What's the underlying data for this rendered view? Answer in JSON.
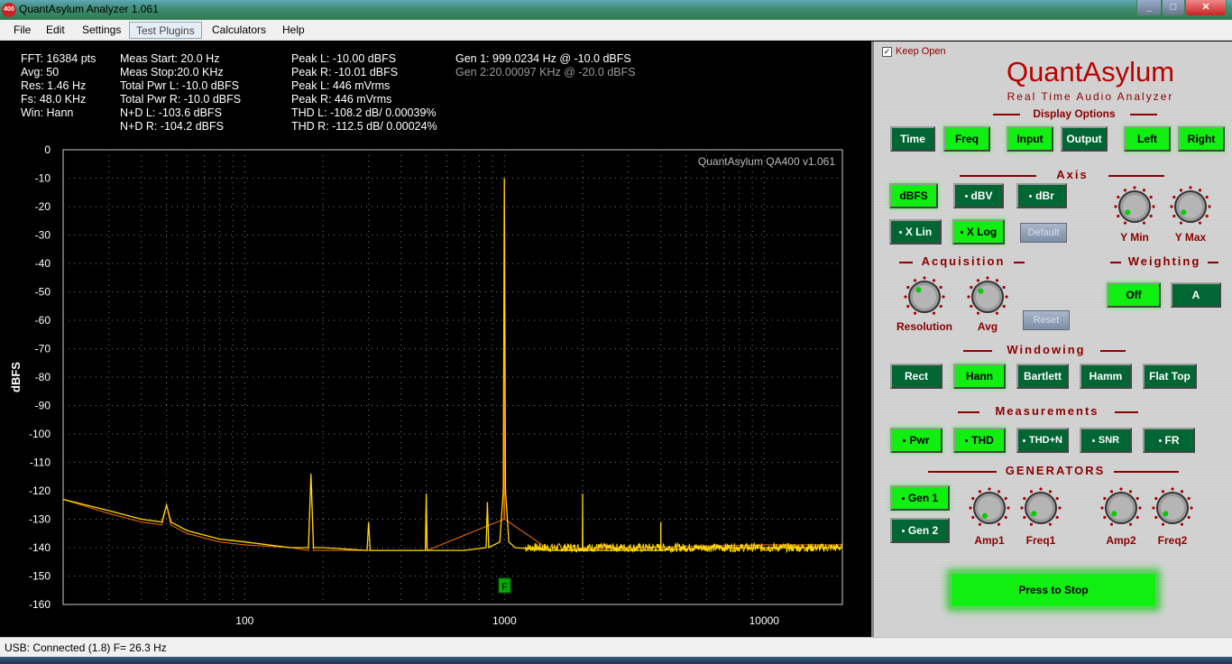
{
  "window": {
    "title": "QuantAsylum Analyzer 1.061",
    "icon_text": "400"
  },
  "menu": [
    "File",
    "Edit",
    "Settings",
    "Test Plugins",
    "Calculators",
    "Help"
  ],
  "stats": {
    "col1": [
      "FFT: 16384 pts",
      "Avg: 50",
      "Res: 1.46 Hz",
      "Fs: 48.0 KHz",
      "Win: Hann"
    ],
    "col2": [
      "Meas Start: 20.0 Hz",
      "Meas Stop:20.0 KHz",
      "Total Pwr L: -10.0 dBFS",
      "Total Pwr R: -10.0 dBFS",
      "N+D L: -103.6 dBFS",
      "N+D R: -104.2 dBFS"
    ],
    "col3": [
      "Peak L: -10.00 dBFS",
      "Peak R: -10.01 dBFS",
      "Peak L: 446 mVrms",
      "Peak R: 446 mVrms",
      "THD L: -108.2 dB/ 0.00039%",
      "THD R: -112.5 dB/ 0.00024%"
    ],
    "col4": [
      "Gen 1: 999.0234 Hz @ -10.0  dBFS",
      "Gen 2:20.00097 KHz @ -20.0  dBFS"
    ]
  },
  "chart_data": {
    "type": "line",
    "ylabel": "dBFS",
    "watermark": "QuantAsylum QA400 v1.061",
    "x_scale": "log",
    "xlim": [
      20,
      20000
    ],
    "ylim": [
      -160,
      0
    ],
    "y_ticks": [
      "0",
      "-10",
      "-20",
      "-30",
      "-40",
      "-50",
      "-60",
      "-70",
      "-80",
      "-90",
      "-100",
      "-110",
      "-120",
      "-130",
      "-140",
      "-150",
      "-160"
    ],
    "x_ticks": [
      {
        "value": 100,
        "label": "100"
      },
      {
        "value": 1000,
        "label": "1000"
      },
      {
        "value": 10000,
        "label": "10000"
      }
    ],
    "grid": true,
    "marker_label": "F",
    "series": [
      {
        "color": "#ffd700",
        "points": [
          [
            20,
            -123
          ],
          [
            30,
            -127
          ],
          [
            40,
            -130
          ],
          [
            48,
            -131
          ],
          [
            50,
            -125
          ],
          [
            52,
            -131
          ],
          [
            60,
            -134
          ],
          [
            80,
            -137
          ],
          [
            100,
            -138
          ],
          [
            150,
            -140
          ],
          [
            176,
            -140
          ],
          [
            180,
            -114
          ],
          [
            184,
            -140
          ],
          [
            200,
            -140
          ],
          [
            296,
            -141
          ],
          [
            300,
            -131
          ],
          [
            304,
            -141
          ],
          [
            400,
            -141
          ],
          [
            496,
            -141
          ],
          [
            500,
            -121
          ],
          [
            504,
            -141
          ],
          [
            700,
            -141
          ],
          [
            850,
            -140
          ],
          [
            860,
            -124
          ],
          [
            870,
            -140
          ],
          [
            960,
            -138
          ],
          [
            990,
            -120
          ],
          [
            999,
            -10
          ],
          [
            1010,
            -120
          ],
          [
            1040,
            -138
          ],
          [
            1100,
            -140
          ],
          [
            1500,
            -141
          ],
          [
            1996,
            -141
          ],
          [
            2000,
            -121
          ],
          [
            2004,
            -141
          ],
          [
            3000,
            -141
          ],
          [
            3996,
            -141
          ],
          [
            4000,
            -131
          ],
          [
            4004,
            -141
          ],
          [
            6000,
            -140
          ],
          [
            10000,
            -140
          ],
          [
            20000,
            -140
          ]
        ]
      },
      {
        "color": "#dd6600",
        "points": [
          [
            20,
            -123
          ],
          [
            30,
            -128
          ],
          [
            40,
            -131
          ],
          [
            48,
            -132
          ],
          [
            50,
            -125
          ],
          [
            52,
            -132
          ],
          [
            60,
            -135
          ],
          [
            80,
            -138
          ],
          [
            100,
            -139
          ],
          [
            150,
            -140
          ],
          [
            176,
            -141
          ],
          [
            180,
            -115
          ],
          [
            184,
            -141
          ],
          [
            300,
            -141
          ],
          [
            496,
            -141
          ],
          [
            500,
            -126
          ],
          [
            504,
            -141
          ],
          [
            996,
            -130
          ],
          [
            999,
            -10
          ],
          [
            1002,
            -130
          ],
          [
            1500,
            -141
          ],
          [
            3000,
            -140
          ],
          [
            10000,
            -139
          ],
          [
            20000,
            -139
          ]
        ]
      }
    ]
  },
  "panel": {
    "keep_open_label": "Keep Open",
    "keep_open_checked": true,
    "brand": "QuantAsylum",
    "subtitle": "Real Time Audio Analyzer",
    "sections": {
      "display": "Display Options",
      "axis": "Axis",
      "acquisition": "Acquisition",
      "weighting": "Weighting",
      "windowing": "Windowing",
      "measurements": "Measurements",
      "generators": "GENERATORS"
    },
    "display_buttons": [
      "Time",
      "Freq",
      "Input",
      "Output",
      "Left",
      "Right"
    ],
    "axis_units": [
      "dBFS",
      "dBV",
      "dBr"
    ],
    "axis_x": [
      "X Lin",
      "X Log"
    ],
    "default_label": "Default",
    "knob_labels": {
      "ymin": "Y Min",
      "ymax": "Y Max",
      "resolution": "Resolution",
      "avg": "Avg",
      "amp1": "Amp1",
      "freq1": "Freq1",
      "amp2": "Amp2",
      "freq2": "Freq2"
    },
    "reset_label": "Reset",
    "weighting_buttons": [
      "Off",
      "A"
    ],
    "window_buttons": [
      "Rect",
      "Hann",
      "Bartlett",
      "Hamm",
      "Flat Top"
    ],
    "measure_buttons": [
      "Pwr",
      "THD",
      "THD+N",
      "SNR",
      "FR"
    ],
    "gen_buttons": [
      "Gen 1",
      "Gen 2"
    ],
    "stop_label": "Press to Stop"
  },
  "status": {
    "text": "USB: Connected  (1.8)  F= 26.3 Hz"
  },
  "colors": {
    "accent_green": "#11ee11",
    "dark_green": "#006633",
    "brand_red": "#8b0000",
    "trace_yellow": "#ffd700",
    "trace_orange": "#dd6600"
  }
}
